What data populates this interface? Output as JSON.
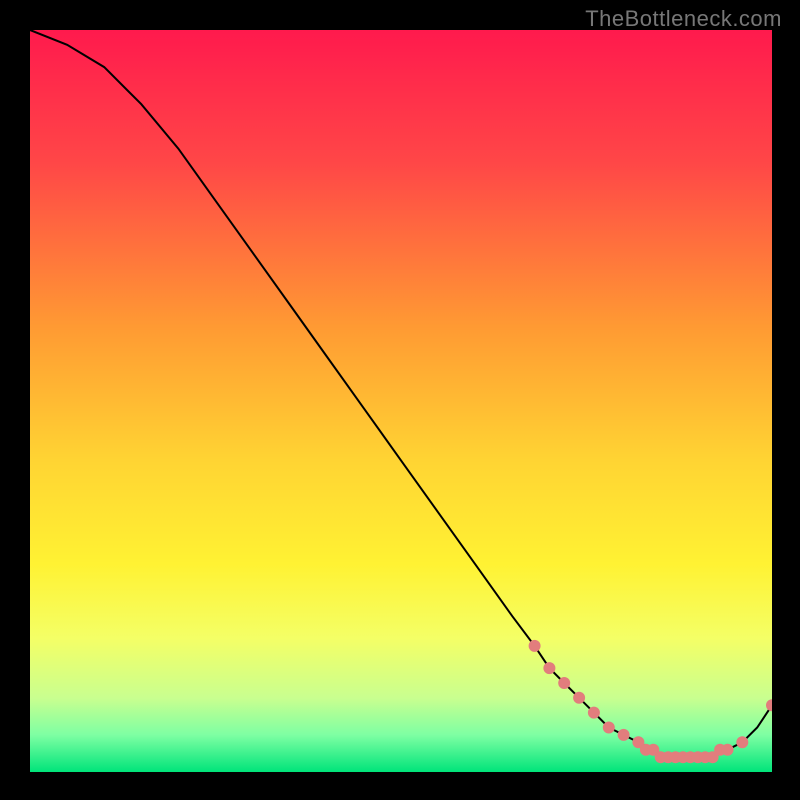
{
  "watermark": "TheBottleneck.com",
  "marker_color": "#e27d7d",
  "marker_radius": 6,
  "chart_data": {
    "type": "line",
    "title": "",
    "xlabel": "",
    "ylabel": "",
    "xlim": [
      0,
      100
    ],
    "ylim": [
      0,
      100
    ],
    "x": [
      0,
      5,
      10,
      15,
      20,
      25,
      30,
      35,
      40,
      45,
      50,
      55,
      60,
      65,
      68,
      70,
      72,
      74,
      76,
      78,
      80,
      82,
      84,
      86,
      88,
      90,
      92,
      94,
      96,
      98,
      100
    ],
    "y": [
      100,
      98,
      95,
      90,
      84,
      77,
      70,
      63,
      56,
      49,
      42,
      35,
      28,
      21,
      17,
      14,
      12,
      10,
      8,
      6,
      5,
      4,
      3,
      2,
      2,
      2,
      2,
      3,
      4,
      6,
      9
    ],
    "markers_x": [
      68,
      70,
      72,
      74,
      76,
      78,
      80,
      82,
      83,
      84,
      85,
      86,
      87,
      88,
      89,
      90,
      91,
      92,
      93,
      94,
      96,
      100
    ],
    "markers_y": [
      17,
      14,
      12,
      10,
      8,
      6,
      5,
      4,
      3,
      3,
      2,
      2,
      2,
      2,
      2,
      2,
      2,
      2,
      3,
      3,
      4,
      9
    ]
  }
}
